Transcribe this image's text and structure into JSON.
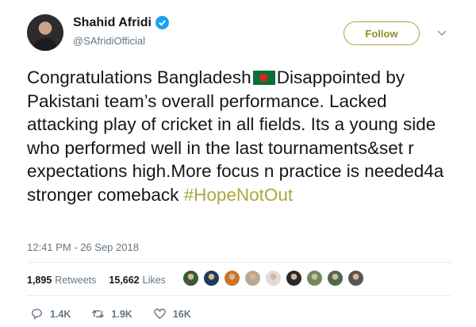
{
  "author": {
    "name": "Shahid Afridi",
    "handle": "@SAfridiOfficial"
  },
  "follow_label": "Follow",
  "tweet": {
    "text_1": "Congratulations Bangladesh",
    "text_2": "Disappointed by Pakistani team’s overall performance. Lacked attacking play of cricket in all fields. Its a young side who performed well in the last tournaments&set r expectations high.More focus n practice is needed4a stronger comeback ",
    "hashtag": "#HopeNotOut",
    "timestamp": "12:41 PM - 26 Sep 2018"
  },
  "stats": {
    "retweets_count": "1,895",
    "retweets_label": "Retweets",
    "likes_count": "15,662",
    "likes_label": "Likes"
  },
  "likers": [
    {
      "color": "#3a5a3a"
    },
    {
      "color": "#1f3b5a"
    },
    {
      "color": "#c9742a"
    },
    {
      "color": "#b8a998"
    },
    {
      "color": "#dcdcdc"
    },
    {
      "color": "#2a2a2a"
    },
    {
      "color": "#6f8a5a"
    },
    {
      "color": "#4a6a4a"
    },
    {
      "color": "#555555"
    }
  ],
  "actions": {
    "reply_count": "1.4K",
    "retweet_count": "1.9K",
    "like_count": "16K"
  },
  "colors": {
    "accent": "#a8a843",
    "verified": "#1da1f2",
    "muted": "#657786"
  }
}
